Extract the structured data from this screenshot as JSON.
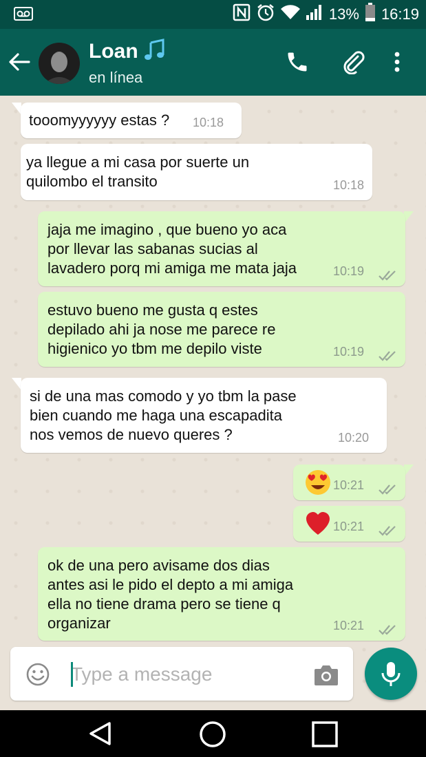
{
  "status_bar": {
    "battery_percent": "13%",
    "time": "16:19",
    "icons": [
      "voicemail-icon",
      "nfc-icon",
      "alarm-icon",
      "wifi-icon",
      "signal-icon",
      "battery-icon"
    ]
  },
  "header": {
    "contact_name": "Loan",
    "contact_status": "en línea",
    "icons": [
      "back-arrow-icon",
      "music-note-icon",
      "phone-icon",
      "paperclip-icon",
      "more-vert-icon"
    ]
  },
  "messages": [
    {
      "direction": "in",
      "text": "tooomyyyyyy estas ?",
      "time": "10:18"
    },
    {
      "direction": "in",
      "text": "ya llegue a mi casa por suerte  un\nquilombo el transito",
      "time": "10:18"
    },
    {
      "direction": "out",
      "text": "jaja me imagino , que bueno yo aca\npor llevar las sabanas sucias al\nlavadero porq mi amiga me mata jaja",
      "time": "10:19",
      "ticks": "double-check-icon"
    },
    {
      "direction": "out",
      "text": "estuvo bueno me gusta q estes\ndepilado ahi ja nose me parece re\nhigienico yo tbm me depilo viste",
      "time": "10:19",
      "ticks": "double-check-icon"
    },
    {
      "direction": "in",
      "text": "si de una mas comodo y yo tbm la pase\nbien cuando me haga una escapadita\nnos vemos de nuevo queres ?",
      "time": "10:20"
    },
    {
      "direction": "out",
      "emoji": "heart-eyes-emoji",
      "time": "10:21",
      "ticks": "double-check-icon"
    },
    {
      "direction": "out",
      "emoji": "red-heart-emoji",
      "time": "10:21",
      "ticks": "double-check-icon"
    },
    {
      "direction": "out",
      "text": "ok de una pero avisame dos dias\nantes asi le pido el depto a mi amiga\nella no tiene drama pero se tiene q\norganizar",
      "time": "10:21",
      "ticks": "double-check-icon"
    }
  ],
  "composer": {
    "placeholder": "Type a message",
    "icons": [
      "emoji-icon",
      "camera-icon",
      "microphone-icon"
    ]
  },
  "nav_bar": {
    "icons": [
      "nav-back-icon",
      "nav-home-icon",
      "nav-recents-icon"
    ]
  },
  "colors": {
    "app_bar": "#075e54",
    "status_bar": "#054d44",
    "outgoing_bubble": "#dcf8c6",
    "incoming_bubble": "#ffffff",
    "accent": "#0a8d7e"
  }
}
